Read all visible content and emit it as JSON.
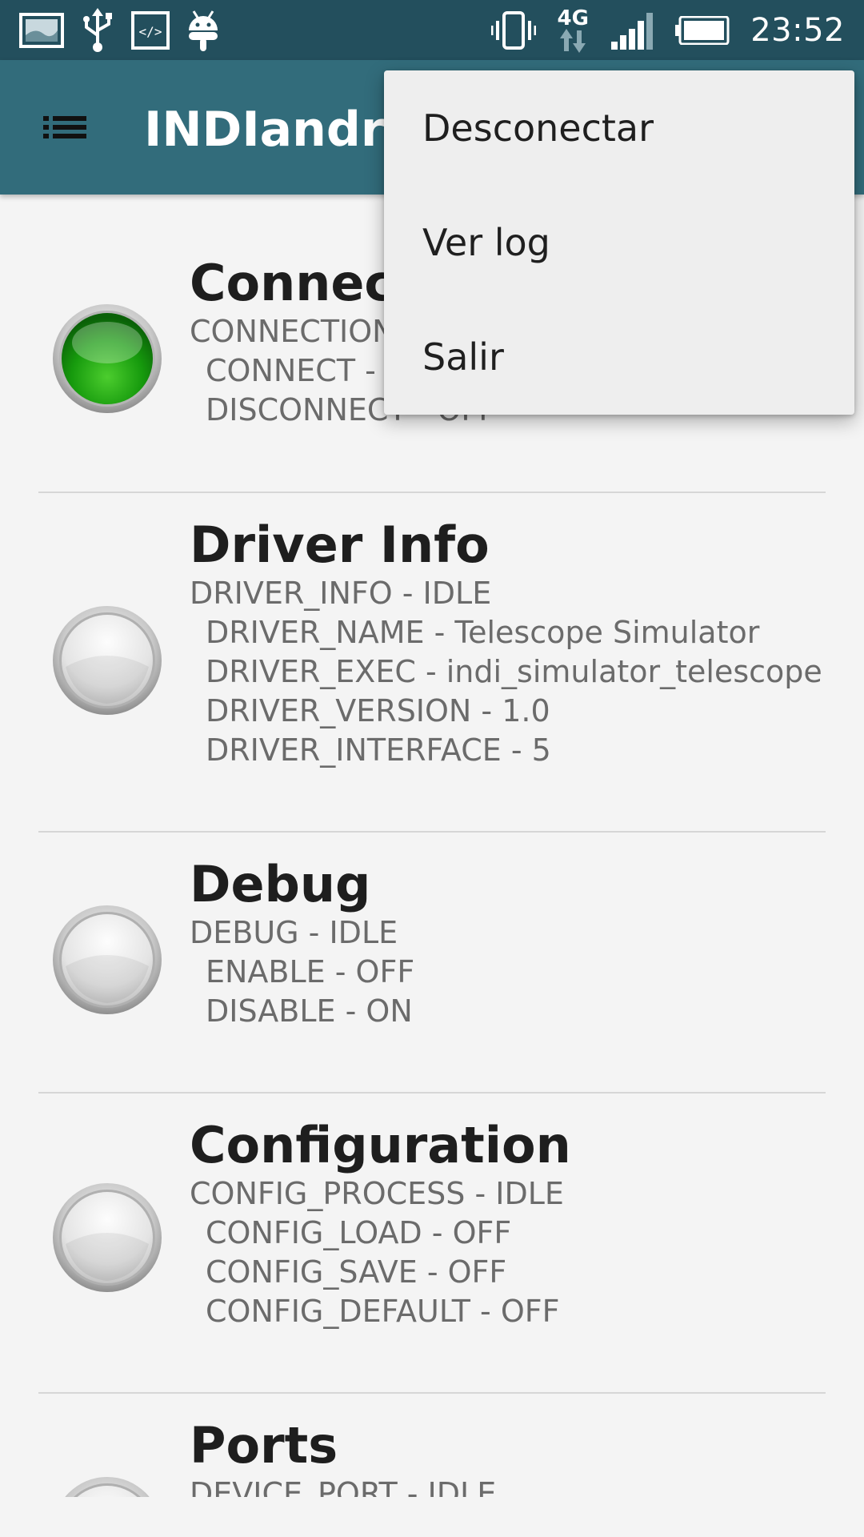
{
  "status_bar": {
    "time": "23:52",
    "network_type": "4G",
    "left_icons": [
      "gallery-icon",
      "usb-icon",
      "code-icon",
      "android-debug-icon"
    ],
    "right_icons": [
      "vibrate-icon",
      "data-arrows-icon",
      "signal-icon",
      "battery-icon"
    ]
  },
  "toolbar": {
    "title": "INDIandroid",
    "nav_icon": "list-icon",
    "background": "#326c7b"
  },
  "menu": {
    "items": [
      {
        "label": "Desconectar"
      },
      {
        "label": "Ver log"
      },
      {
        "label": "Salir"
      }
    ]
  },
  "properties": [
    {
      "title": "Connection",
      "status": "ok",
      "property_line": "CONNECTION - OK",
      "elements": [
        "CONNECT - ON",
        "DISCONNECT - OFF"
      ]
    },
    {
      "title": "Driver Info",
      "status": "idle",
      "property_line": "DRIVER_INFO - IDLE",
      "elements": [
        "DRIVER_NAME - Telescope Simulator",
        "DRIVER_EXEC - indi_simulator_telescope",
        "DRIVER_VERSION - 1.0",
        "DRIVER_INTERFACE - 5"
      ]
    },
    {
      "title": "Debug",
      "status": "idle",
      "property_line": "DEBUG - IDLE",
      "elements": [
        "ENABLE - OFF",
        "DISABLE - ON"
      ]
    },
    {
      "title": "Configuration",
      "status": "idle",
      "property_line": "CONFIG_PROCESS - IDLE",
      "elements": [
        "CONFIG_LOAD - OFF",
        "CONFIG_SAVE - OFF",
        "CONFIG_DEFAULT - OFF"
      ]
    },
    {
      "title": "Ports",
      "status": "idle",
      "property_line": "DEVICE_PORT - IDLE",
      "elements": []
    }
  ],
  "colors": {
    "status_bar": "#234f5d",
    "toolbar": "#326c7b",
    "led_ok": "#1a9a12",
    "led_idle": "#d8d8d8"
  }
}
